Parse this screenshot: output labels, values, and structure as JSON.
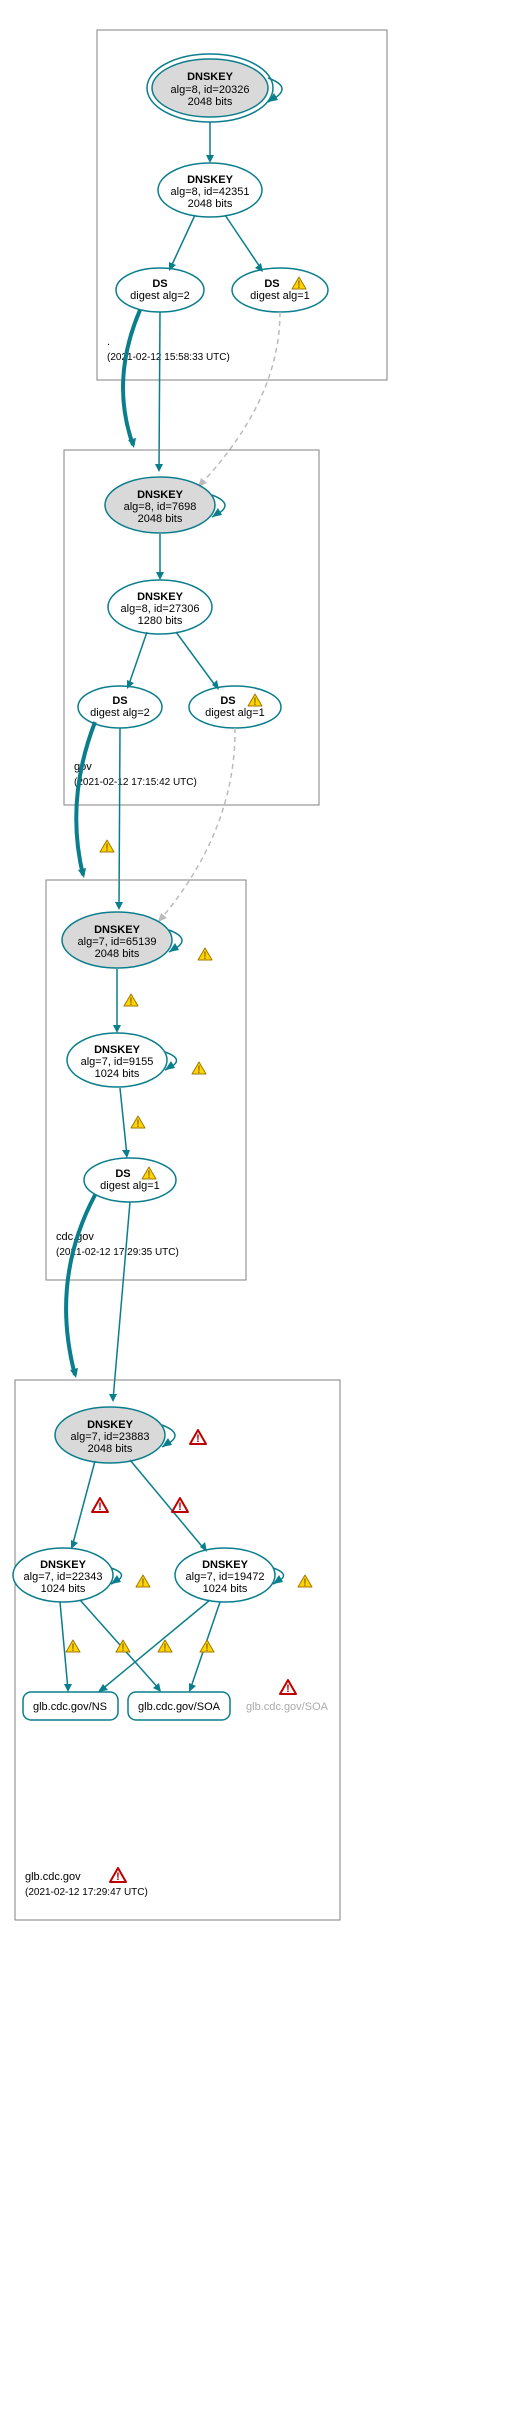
{
  "zones": {
    "root": {
      "name": ".",
      "timestamp": "(2021-02-12 15:58:33 UTC)"
    },
    "gov": {
      "name": "gov",
      "timestamp": "(2021-02-12 17:15:42 UTC)"
    },
    "cdc": {
      "name": "cdc.gov",
      "timestamp": "(2021-02-12 17:29:35 UTC)"
    },
    "glb": {
      "name": "glb.cdc.gov",
      "timestamp": "(2021-02-12 17:29:47 UTC)"
    }
  },
  "nodes": {
    "root_ksk": {
      "title": "DNSKEY",
      "line1": "alg=8, id=20326",
      "line2": "2048 bits"
    },
    "root_zsk": {
      "title": "DNSKEY",
      "line1": "alg=8, id=42351",
      "line2": "2048 bits"
    },
    "root_ds2": {
      "title": "DS",
      "line1": "digest alg=2"
    },
    "root_ds1": {
      "title": "DS",
      "line1": "digest alg=1"
    },
    "gov_ksk": {
      "title": "DNSKEY",
      "line1": "alg=8, id=7698",
      "line2": "2048 bits"
    },
    "gov_zsk": {
      "title": "DNSKEY",
      "line1": "alg=8, id=27306",
      "line2": "1280 bits"
    },
    "gov_ds2": {
      "title": "DS",
      "line1": "digest alg=2"
    },
    "gov_ds1": {
      "title": "DS",
      "line1": "digest alg=1"
    },
    "cdc_ksk": {
      "title": "DNSKEY",
      "line1": "alg=7, id=65139",
      "line2": "2048 bits"
    },
    "cdc_zsk": {
      "title": "DNSKEY",
      "line1": "alg=7, id=9155",
      "line2": "1024 bits"
    },
    "cdc_ds1": {
      "title": "DS",
      "line1": "digest alg=1"
    },
    "glb_ksk": {
      "title": "DNSKEY",
      "line1": "alg=7, id=23883",
      "line2": "2048 bits"
    },
    "glb_zskA": {
      "title": "DNSKEY",
      "line1": "alg=7, id=22343",
      "line2": "1024 bits"
    },
    "glb_zskB": {
      "title": "DNSKEY",
      "line1": "alg=7, id=19472",
      "line2": "1024 bits"
    },
    "glb_ns": {
      "title": "glb.cdc.gov/NS"
    },
    "glb_soa": {
      "title": "glb.cdc.gov/SOA"
    },
    "glb_soa2": {
      "title": "glb.cdc.gov/SOA"
    }
  }
}
